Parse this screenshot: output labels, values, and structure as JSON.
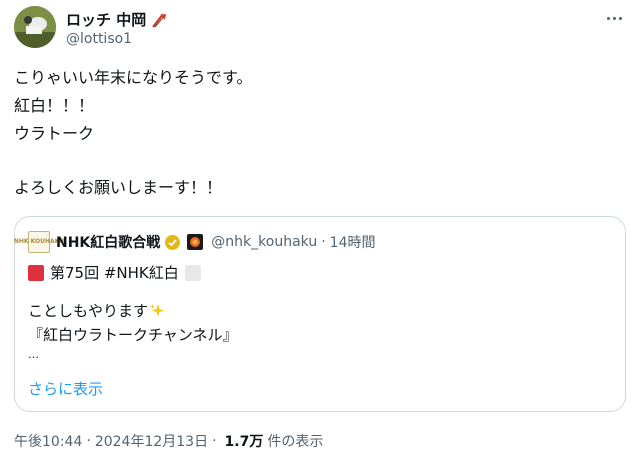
{
  "author": {
    "display_name": "ロッチ 中岡",
    "name_emoji": "flag-emoji",
    "handle": "@lottiso1",
    "avatar": "avatar-photo"
  },
  "more_icon": "more-options-icon",
  "body": {
    "lines": [
      "こりゃいい年末になりそうです。",
      "紅白！！！",
      "ウラトーク",
      "",
      "よろしくお願いしまーす！！"
    ]
  },
  "quote": {
    "display_name": "NHK紅白歌合戦",
    "verified_icon": "gold-verified-icon",
    "affiliate_icon": "nhk-badge-icon",
    "handle": "@nhk_kouhaku",
    "dot": "·",
    "time": "14時間",
    "avatar_text": "NHK KOUHAKU",
    "line1": "第75回 #NHK紅白",
    "line2": "ことしもやります",
    "line3": "『紅白ウラトークチャンネル』",
    "ellipsis": "…",
    "show_more": "さらに表示",
    "colors": {
      "link": "#1d9bf0",
      "red_square": "#e0303e"
    }
  },
  "footer": {
    "time": "午後10:44",
    "sep": "·",
    "date": "2024年12月13日",
    "views_count": "1.7万",
    "views_label": "件の表示"
  }
}
